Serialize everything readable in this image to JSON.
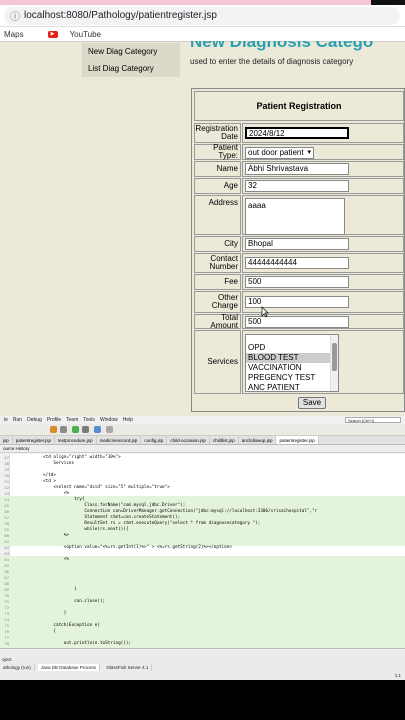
{
  "browser": {
    "url": "localhost:8080/Pathology/patientregister.jsp",
    "bookmarks": [
      "Maps",
      "YouTube"
    ]
  },
  "sidebar": {
    "items": [
      "New Diag Category",
      "List Diag Category"
    ]
  },
  "page": {
    "heading": "New Diagnosis Catego",
    "subtitle": "used to enter the details of diagnosis category"
  },
  "form": {
    "title": "Patient Registration",
    "registration_date_label": "Registration Date",
    "registration_date": "2024/8/12",
    "patient_type_label": "Patient Type:",
    "patient_type": "out door patient",
    "name_label": "Name",
    "name": "Abhi Shrivastava",
    "age_label": "Age",
    "age": "32",
    "address_label": "Address",
    "address": "aaaa",
    "city_label": "City",
    "city": "Bhopal",
    "contact_label": "Contact Number",
    "contact": "44444444444",
    "fee_label": "Fee",
    "fee": "500",
    "other_charge_label": "Other Charge",
    "other_charge": "100",
    "total_label": "Total Amount",
    "total": "500",
    "services_label": "Services",
    "services": [
      "OPD",
      "BLOOD TEST",
      "VACCINATION",
      "PREGENCY TEST",
      "ANC PATIENT"
    ],
    "save_label": "Save"
  },
  "ide": {
    "menu": [
      "le",
      "Run",
      "Debug",
      "Profile",
      "Team",
      "Tools",
      "Window",
      "Help"
    ],
    "search_placeholder": "Search (Ctrl+I)",
    "tabs": [
      "jsp",
      "patientregister.jsp",
      "testprocedure.jsp",
      "medicinerecord.jsp",
      "config.jsp",
      "child-occasion.jsp",
      "childlist.jsp",
      "ancfollowup.jsp",
      "patientregister.jsp"
    ],
    "editor_tabs": "ource   History",
    "code_lines": [
      {
        "n": "47",
        "t": "            <td align=\"right\" width=\"10%\">",
        "hl": false
      },
      {
        "n": "48",
        "t": "                Services",
        "hl": false
      },
      {
        "n": "49",
        "t": "",
        "hl": false
      },
      {
        "n": "50",
        "t": "            </td>",
        "hl": false
      },
      {
        "n": "51",
        "t": "            <td >",
        "hl": false
      },
      {
        "n": "52",
        "t": "                <select name=\"dsid\" size=\"5\" multiple=\"true\">",
        "hl": false
      },
      {
        "n": "53",
        "t": "                    <%",
        "hl": false
      },
      {
        "n": "54",
        "t": "                        try{",
        "hl": true
      },
      {
        "n": "55",
        "t": "                            Class.forName(\"com.mysql.jdbc.Driver\");",
        "hl": true
      },
      {
        "n": "56",
        "t": "                            Connection con=DriverManager.getConnection(\"jdbc:mysql://localhost:3306/srisaihospital\",\"r",
        "hl": true
      },
      {
        "n": "57",
        "t": "                            Statement stmt=con.createStatement();",
        "hl": true
      },
      {
        "n": "58",
        "t": "                            ResultSet rs = stmt.executeQuery(\"select * from diagnosecategory \");",
        "hl": true
      },
      {
        "n": "59",
        "t": "                            while(rs.next()){",
        "hl": true
      },
      {
        "n": "60",
        "t": "                    %>",
        "hl": true
      },
      {
        "n": "61",
        "t": "",
        "hl": true
      },
      {
        "n": "62",
        "t": "                    <option value=\"<%=rs.getInt(1)%>\" > <%=rs.getString(2)%></option>",
        "hl": false
      },
      {
        "n": "63",
        "t": "",
        "hl": false
      },
      {
        "n": "64",
        "t": "                    <%",
        "hl": true
      },
      {
        "n": "65",
        "t": "",
        "hl": true
      },
      {
        "n": "66",
        "t": "",
        "hl": true
      },
      {
        "n": "67",
        "t": "",
        "hl": true
      },
      {
        "n": "68",
        "t": "",
        "hl": true
      },
      {
        "n": "69",
        "t": "                        }",
        "hl": true
      },
      {
        "n": "70",
        "t": "",
        "hl": true
      },
      {
        "n": "71",
        "t": "                        con.close();",
        "hl": true
      },
      {
        "n": "72",
        "t": "",
        "hl": true
      },
      {
        "n": "73",
        "t": "                    }",
        "hl": true
      },
      {
        "n": "74",
        "t": "",
        "hl": true
      },
      {
        "n": "75",
        "t": "                catch(Exception e)",
        "hl": true
      },
      {
        "n": "76",
        "t": "                {",
        "hl": true
      },
      {
        "n": "77",
        "t": "",
        "hl": true
      },
      {
        "n": "78",
        "t": "                    out.println(e.toString());",
        "hl": true
      }
    ],
    "bottom_left": "oject",
    "output_tabs": [
      "athology (run)",
      "Java DB Database Process",
      "GlassFish Server 4.1"
    ],
    "cursor_pos": "1:1"
  },
  "colors": {
    "heading": "#2aa0b0",
    "code_highlight": "#e4f4dc"
  }
}
